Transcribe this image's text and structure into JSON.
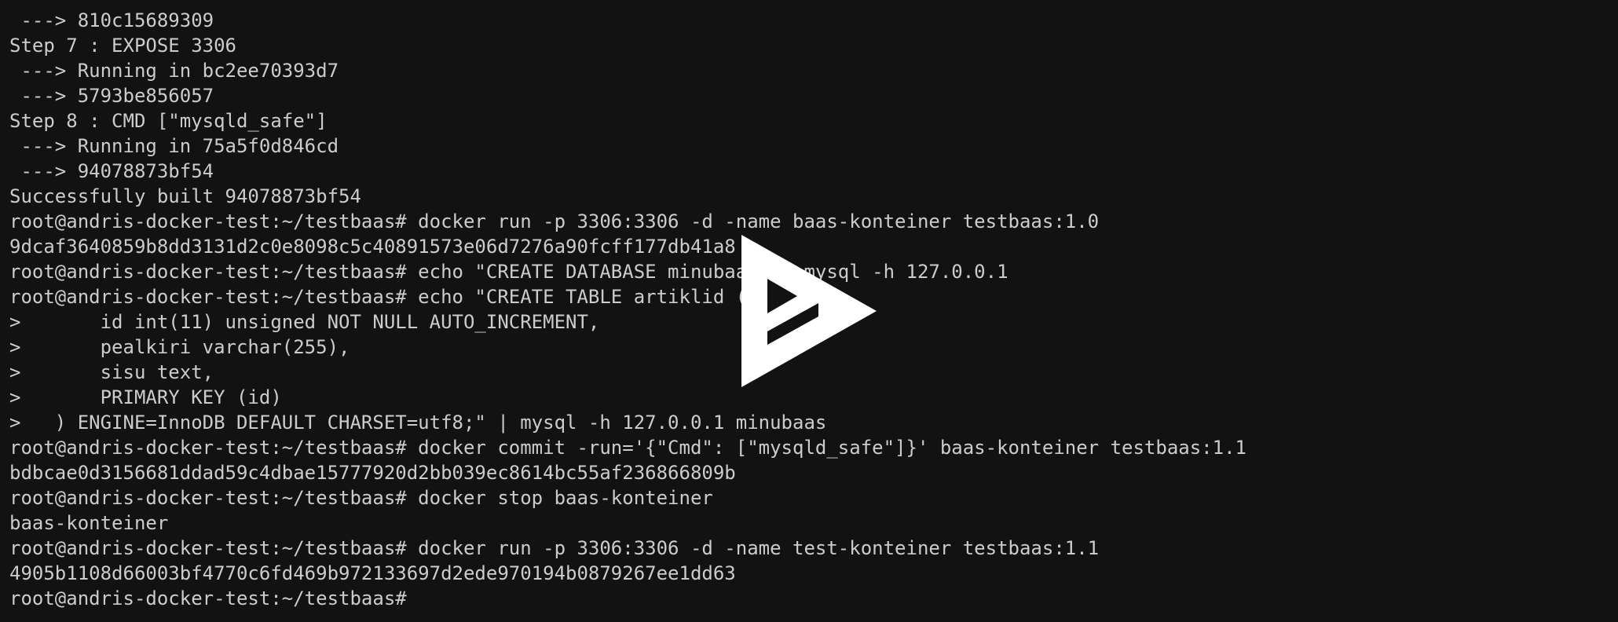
{
  "colors": {
    "background": "#121212",
    "foreground": "#cccccc",
    "overlay": "#ffffff"
  },
  "terminal": {
    "lines": [
      " ---> 810c15689309",
      "Step 7 : EXPOSE 3306",
      " ---> Running in bc2ee70393d7",
      " ---> 5793be856057",
      "Step 8 : CMD [\"mysqld_safe\"]",
      " ---> Running in 75a5f0d846cd",
      " ---> 94078873bf54",
      "Successfully built 94078873bf54",
      "root@andris-docker-test:~/testbaas# docker run -p 3306:3306 -d -name baas-konteiner testbaas:1.0",
      "9dcaf3640859b8dd3131d2c0e8098c5c40891573e06d7276a90fcff177db41a8",
      "root@andris-docker-test:~/testbaas# echo \"CREATE DATABASE minubaas\" | mysql -h 127.0.0.1",
      "root@andris-docker-test:~/testbaas# echo \"CREATE TABLE artiklid (",
      ">       id int(11) unsigned NOT NULL AUTO_INCREMENT,",
      ">       pealkiri varchar(255),",
      ">       sisu text,",
      ">       PRIMARY KEY (id)",
      ">   ) ENGINE=InnoDB DEFAULT CHARSET=utf8;\" | mysql -h 127.0.0.1 minubaas",
      "root@andris-docker-test:~/testbaas# docker commit -run='{\"Cmd\": [\"mysqld_safe\"]}' baas-konteiner testbaas:1.1",
      "bdbcae0d3156681ddad59c4dbae15777920d2bb039ec8614bc55af236866809b",
      "root@andris-docker-test:~/testbaas# docker stop baas-konteiner",
      "baas-konteiner",
      "root@andris-docker-test:~/testbaas# docker run -p 3306:3306 -d -name test-konteiner testbaas:1.1",
      "4905b1108d66003bf4770c6fd469b972133697d2ede970194b0879267ee1dd63",
      "root@andris-docker-test:~/testbaas#"
    ]
  },
  "overlay": {
    "icon": "asciinema-play-icon"
  }
}
